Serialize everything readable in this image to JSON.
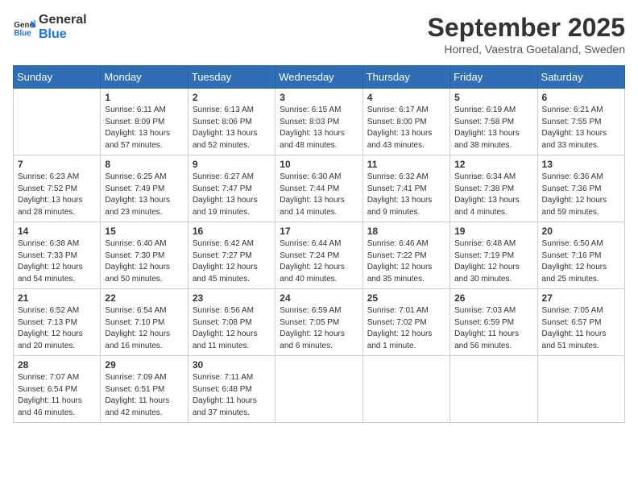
{
  "header": {
    "logo_line1": "General",
    "logo_line2": "Blue",
    "month": "September 2025",
    "location": "Horred, Vaestra Goetaland, Sweden"
  },
  "weekdays": [
    "Sunday",
    "Monday",
    "Tuesday",
    "Wednesday",
    "Thursday",
    "Friday",
    "Saturday"
  ],
  "weeks": [
    [
      {
        "day": "",
        "info": ""
      },
      {
        "day": "1",
        "info": "Sunrise: 6:11 AM\nSunset: 8:09 PM\nDaylight: 13 hours\nand 57 minutes."
      },
      {
        "day": "2",
        "info": "Sunrise: 6:13 AM\nSunset: 8:06 PM\nDaylight: 13 hours\nand 52 minutes."
      },
      {
        "day": "3",
        "info": "Sunrise: 6:15 AM\nSunset: 8:03 PM\nDaylight: 13 hours\nand 48 minutes."
      },
      {
        "day": "4",
        "info": "Sunrise: 6:17 AM\nSunset: 8:00 PM\nDaylight: 13 hours\nand 43 minutes."
      },
      {
        "day": "5",
        "info": "Sunrise: 6:19 AM\nSunset: 7:58 PM\nDaylight: 13 hours\nand 38 minutes."
      },
      {
        "day": "6",
        "info": "Sunrise: 6:21 AM\nSunset: 7:55 PM\nDaylight: 13 hours\nand 33 minutes."
      }
    ],
    [
      {
        "day": "7",
        "info": "Sunrise: 6:23 AM\nSunset: 7:52 PM\nDaylight: 13 hours\nand 28 minutes."
      },
      {
        "day": "8",
        "info": "Sunrise: 6:25 AM\nSunset: 7:49 PM\nDaylight: 13 hours\nand 23 minutes."
      },
      {
        "day": "9",
        "info": "Sunrise: 6:27 AM\nSunset: 7:47 PM\nDaylight: 13 hours\nand 19 minutes."
      },
      {
        "day": "10",
        "info": "Sunrise: 6:30 AM\nSunset: 7:44 PM\nDaylight: 13 hours\nand 14 minutes."
      },
      {
        "day": "11",
        "info": "Sunrise: 6:32 AM\nSunset: 7:41 PM\nDaylight: 13 hours\nand 9 minutes."
      },
      {
        "day": "12",
        "info": "Sunrise: 6:34 AM\nSunset: 7:38 PM\nDaylight: 13 hours\nand 4 minutes."
      },
      {
        "day": "13",
        "info": "Sunrise: 6:36 AM\nSunset: 7:36 PM\nDaylight: 12 hours\nand 59 minutes."
      }
    ],
    [
      {
        "day": "14",
        "info": "Sunrise: 6:38 AM\nSunset: 7:33 PM\nDaylight: 12 hours\nand 54 minutes."
      },
      {
        "day": "15",
        "info": "Sunrise: 6:40 AM\nSunset: 7:30 PM\nDaylight: 12 hours\nand 50 minutes."
      },
      {
        "day": "16",
        "info": "Sunrise: 6:42 AM\nSunset: 7:27 PM\nDaylight: 12 hours\nand 45 minutes."
      },
      {
        "day": "17",
        "info": "Sunrise: 6:44 AM\nSunset: 7:24 PM\nDaylight: 12 hours\nand 40 minutes."
      },
      {
        "day": "18",
        "info": "Sunrise: 6:46 AM\nSunset: 7:22 PM\nDaylight: 12 hours\nand 35 minutes."
      },
      {
        "day": "19",
        "info": "Sunrise: 6:48 AM\nSunset: 7:19 PM\nDaylight: 12 hours\nand 30 minutes."
      },
      {
        "day": "20",
        "info": "Sunrise: 6:50 AM\nSunset: 7:16 PM\nDaylight: 12 hours\nand 25 minutes."
      }
    ],
    [
      {
        "day": "21",
        "info": "Sunrise: 6:52 AM\nSunset: 7:13 PM\nDaylight: 12 hours\nand 20 minutes."
      },
      {
        "day": "22",
        "info": "Sunrise: 6:54 AM\nSunset: 7:10 PM\nDaylight: 12 hours\nand 16 minutes."
      },
      {
        "day": "23",
        "info": "Sunrise: 6:56 AM\nSunset: 7:08 PM\nDaylight: 12 hours\nand 11 minutes."
      },
      {
        "day": "24",
        "info": "Sunrise: 6:59 AM\nSunset: 7:05 PM\nDaylight: 12 hours\nand 6 minutes."
      },
      {
        "day": "25",
        "info": "Sunrise: 7:01 AM\nSunset: 7:02 PM\nDaylight: 12 hours\nand 1 minute."
      },
      {
        "day": "26",
        "info": "Sunrise: 7:03 AM\nSunset: 6:59 PM\nDaylight: 11 hours\nand 56 minutes."
      },
      {
        "day": "27",
        "info": "Sunrise: 7:05 AM\nSunset: 6:57 PM\nDaylight: 11 hours\nand 51 minutes."
      }
    ],
    [
      {
        "day": "28",
        "info": "Sunrise: 7:07 AM\nSunset: 6:54 PM\nDaylight: 11 hours\nand 46 minutes."
      },
      {
        "day": "29",
        "info": "Sunrise: 7:09 AM\nSunset: 6:51 PM\nDaylight: 11 hours\nand 42 minutes."
      },
      {
        "day": "30",
        "info": "Sunrise: 7:11 AM\nSunset: 6:48 PM\nDaylight: 11 hours\nand 37 minutes."
      },
      {
        "day": "",
        "info": ""
      },
      {
        "day": "",
        "info": ""
      },
      {
        "day": "",
        "info": ""
      },
      {
        "day": "",
        "info": ""
      }
    ]
  ]
}
